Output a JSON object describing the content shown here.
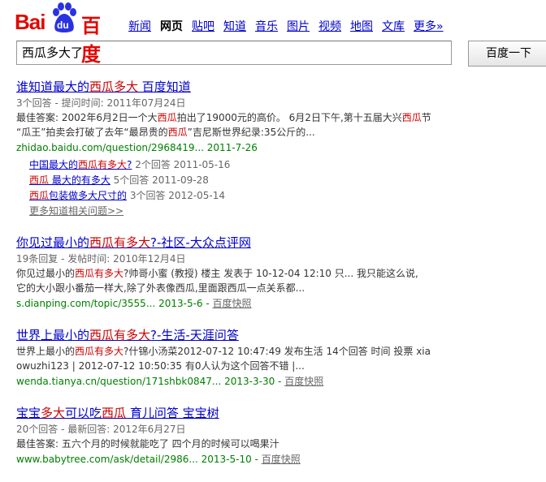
{
  "logo": {
    "bai": "Bai",
    "du": "du",
    "cn": "百度"
  },
  "nav": [
    "新闻",
    "网页",
    "贴吧",
    "知道",
    "音乐",
    "图片",
    "视频",
    "地图",
    "文库",
    "更多»"
  ],
  "nav_current": 1,
  "search": {
    "value": "西瓜多大了",
    "button": "百度一下"
  },
  "results": [
    {
      "title": [
        [
          "谁知道最大的",
          0
        ],
        [
          "西瓜多大",
          1
        ],
        [
          "  百度知道",
          0
        ]
      ],
      "meta": "3个回答 - 提问时间: 2011年07月24日",
      "abstract": [
        [
          [
            "最佳答案: 2002年6月2日一个大",
            0
          ],
          [
            "西瓜",
            1
          ],
          [
            "拍出了19000元的高价。 6月2日下午,第十五届大兴",
            0
          ],
          [
            "西瓜",
            1
          ],
          [
            "节",
            0
          ]
        ],
        [
          [
            "“瓜王”拍卖会打破了去年“最昂贵的",
            0
          ],
          [
            "西瓜",
            1
          ],
          [
            "”吉尼斯世界纪录:35公斤的...",
            0
          ]
        ]
      ],
      "url": "zhidao.baidu.com/question/2968419...  2011-7-26",
      "cache": "",
      "subs": [
        {
          "t": [
            [
              "中国最大的",
              0
            ],
            [
              "西瓜有多大",
              1
            ],
            [
              "?",
              0
            ]
          ],
          "m": "2个回答 2011-05-16"
        },
        {
          "t": [
            [
              "西瓜",
              1
            ],
            [
              "  最大的有多大",
              0
            ]
          ],
          "m": "5个回答 2011-09-28"
        },
        {
          "t": [
            [
              "西瓜",
              1
            ],
            [
              "包装做多大尺寸的",
              0
            ]
          ],
          "m": "3个回答 2012-05-14"
        }
      ],
      "more": "更多知道相关问题>>"
    },
    {
      "title": [
        [
          "你见过最小的",
          0
        ],
        [
          "西瓜有多大",
          1
        ],
        [
          "?-社区-大众点评网",
          0
        ]
      ],
      "meta": "19条回复 - 发帖时间: 2010年12月4日",
      "abstract": [
        [
          [
            "你见过最小的",
            0
          ],
          [
            "西瓜有多大",
            1
          ],
          [
            "?帅哥小蜜 (教授) 楼主 发表于 10-12-04 12:10 只... 我只能这么说,",
            0
          ]
        ],
        [
          [
            "它的大小跟小番茄一样大,除了外表像西瓜,里面跟西瓜一点关系都...",
            0
          ]
        ]
      ],
      "url": "s.dianping.com/topic/3555...  2013-5-6  - ",
      "cache": "百度快照",
      "subs": [],
      "more": ""
    },
    {
      "title": [
        [
          "世界上最小的",
          0
        ],
        [
          "西瓜有多大",
          1
        ],
        [
          "?-生活-天涯问答",
          0
        ]
      ],
      "meta": "",
      "abstract": [
        [
          [
            "世界上最小的",
            0
          ],
          [
            "西瓜有多大",
            1
          ],
          [
            "?什锦小汤菜2012-07-12 10:47:49 发布生活  14个回答  时间  投票  xia",
            0
          ]
        ],
        [
          [
            "owuzhi123 | 2012-07-12 10:50:35 有0人认为这个回答不错  |...",
            0
          ]
        ]
      ],
      "url": "wenda.tianya.cn/question/171shbk0847...  2013-3-30  - ",
      "cache": "百度快照",
      "subs": [],
      "more": ""
    },
    {
      "title": [
        [
          "宝宝",
          0
        ],
        [
          "多大",
          1
        ],
        [
          "可以吃",
          0
        ],
        [
          "西瓜",
          1
        ],
        [
          "  育儿问答  宝宝树",
          0
        ]
      ],
      "meta": "20个回答 - 最新回答: 2012年6月27日",
      "abstract": [
        [
          [
            "最佳答案: 五六个月的时候就能吃了  四个月的时候可以喝果汁",
            0
          ]
        ]
      ],
      "url": "www.babytree.com/ask/detail/2986...  2013-5-10  - ",
      "cache": "百度快照",
      "subs": [],
      "more": ""
    }
  ],
  "colors": {
    "link": "#0000cc",
    "highlight": "#cc0000",
    "url": "#008000",
    "brand": "#e10601"
  }
}
